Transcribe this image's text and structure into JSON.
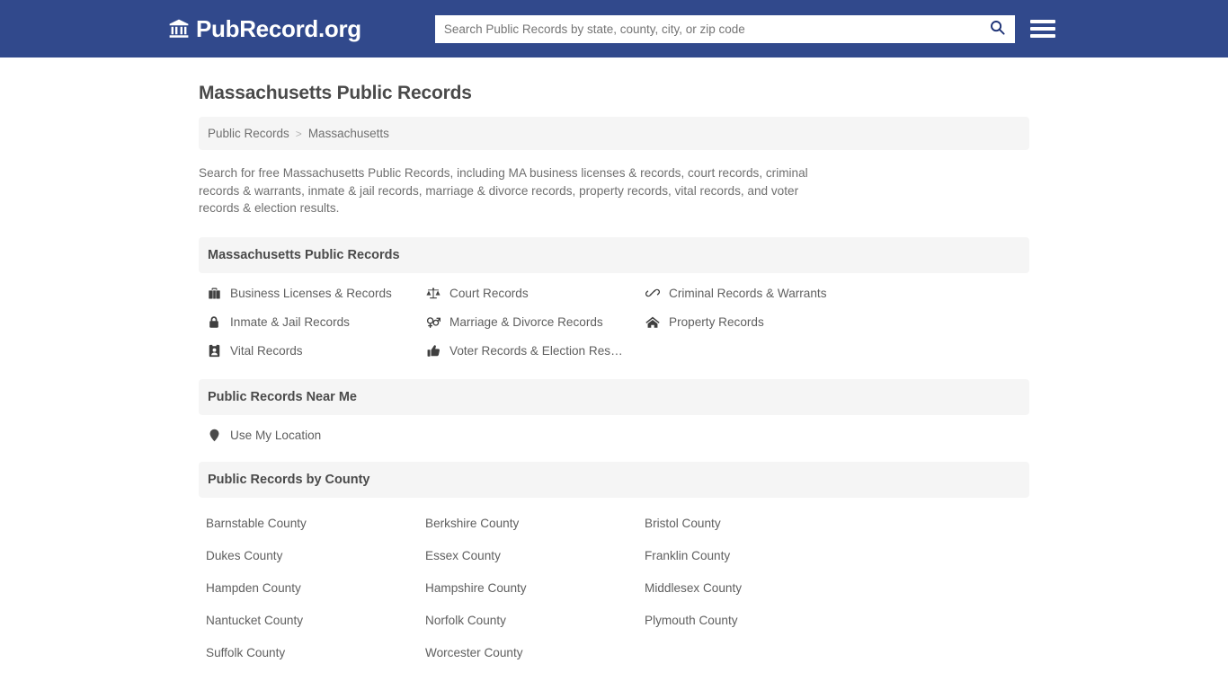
{
  "header": {
    "brand_name": "PubRecord.org",
    "brand_icon": "bank-icon",
    "search": {
      "placeholder": "Search Public Records by state, county, city, or zip code",
      "value": "",
      "button_icon": "search-icon"
    },
    "menu_icon": "hamburger-menu-icon",
    "background_color": "#31498c"
  },
  "page_title": "Massachusetts Public Records",
  "breadcrumb": {
    "items": [
      {
        "label": "Public Records"
      },
      {
        "label": "Massachusetts"
      }
    ],
    "separator": ">"
  },
  "intro": "Search for free Massachusetts Public Records, including MA business licenses & records, court records, criminal records & warrants, inmate & jail records, marriage & divorce records, property records, vital records, and voter records & election results.",
  "sections": {
    "records": {
      "title": "Massachusetts Public Records",
      "links": [
        {
          "label": "Business Licenses & Records",
          "icon": "briefcase-icon"
        },
        {
          "label": "Court Records",
          "icon": "balance-scale-icon"
        },
        {
          "label": "Criminal Records & Warrants",
          "icon": "handcuffs-icon"
        },
        {
          "label": "Inmate & Jail Records",
          "icon": "lock-icon"
        },
        {
          "label": "Marriage & Divorce Records",
          "icon": "venus-mars-icon"
        },
        {
          "label": "Property Records",
          "icon": "home-icon"
        },
        {
          "label": "Vital Records",
          "icon": "id-badge-icon"
        },
        {
          "label": "Voter Records & Election Res…",
          "icon": "thumbs-up-icon"
        }
      ]
    },
    "near_me": {
      "title": "Public Records Near Me",
      "links": [
        {
          "label": "Use My Location",
          "icon": "map-marker-icon"
        }
      ]
    },
    "counties": {
      "title": "Public Records by County",
      "links": [
        {
          "label": "Barnstable County"
        },
        {
          "label": "Berkshire County"
        },
        {
          "label": "Bristol County"
        },
        {
          "label": "Dukes County"
        },
        {
          "label": "Essex County"
        },
        {
          "label": "Franklin County"
        },
        {
          "label": "Hampden County"
        },
        {
          "label": "Hampshire County"
        },
        {
          "label": "Middlesex County"
        },
        {
          "label": "Nantucket County"
        },
        {
          "label": "Norfolk County"
        },
        {
          "label": "Plymouth County"
        },
        {
          "label": "Suffolk County"
        },
        {
          "label": "Worcester County"
        }
      ]
    }
  }
}
